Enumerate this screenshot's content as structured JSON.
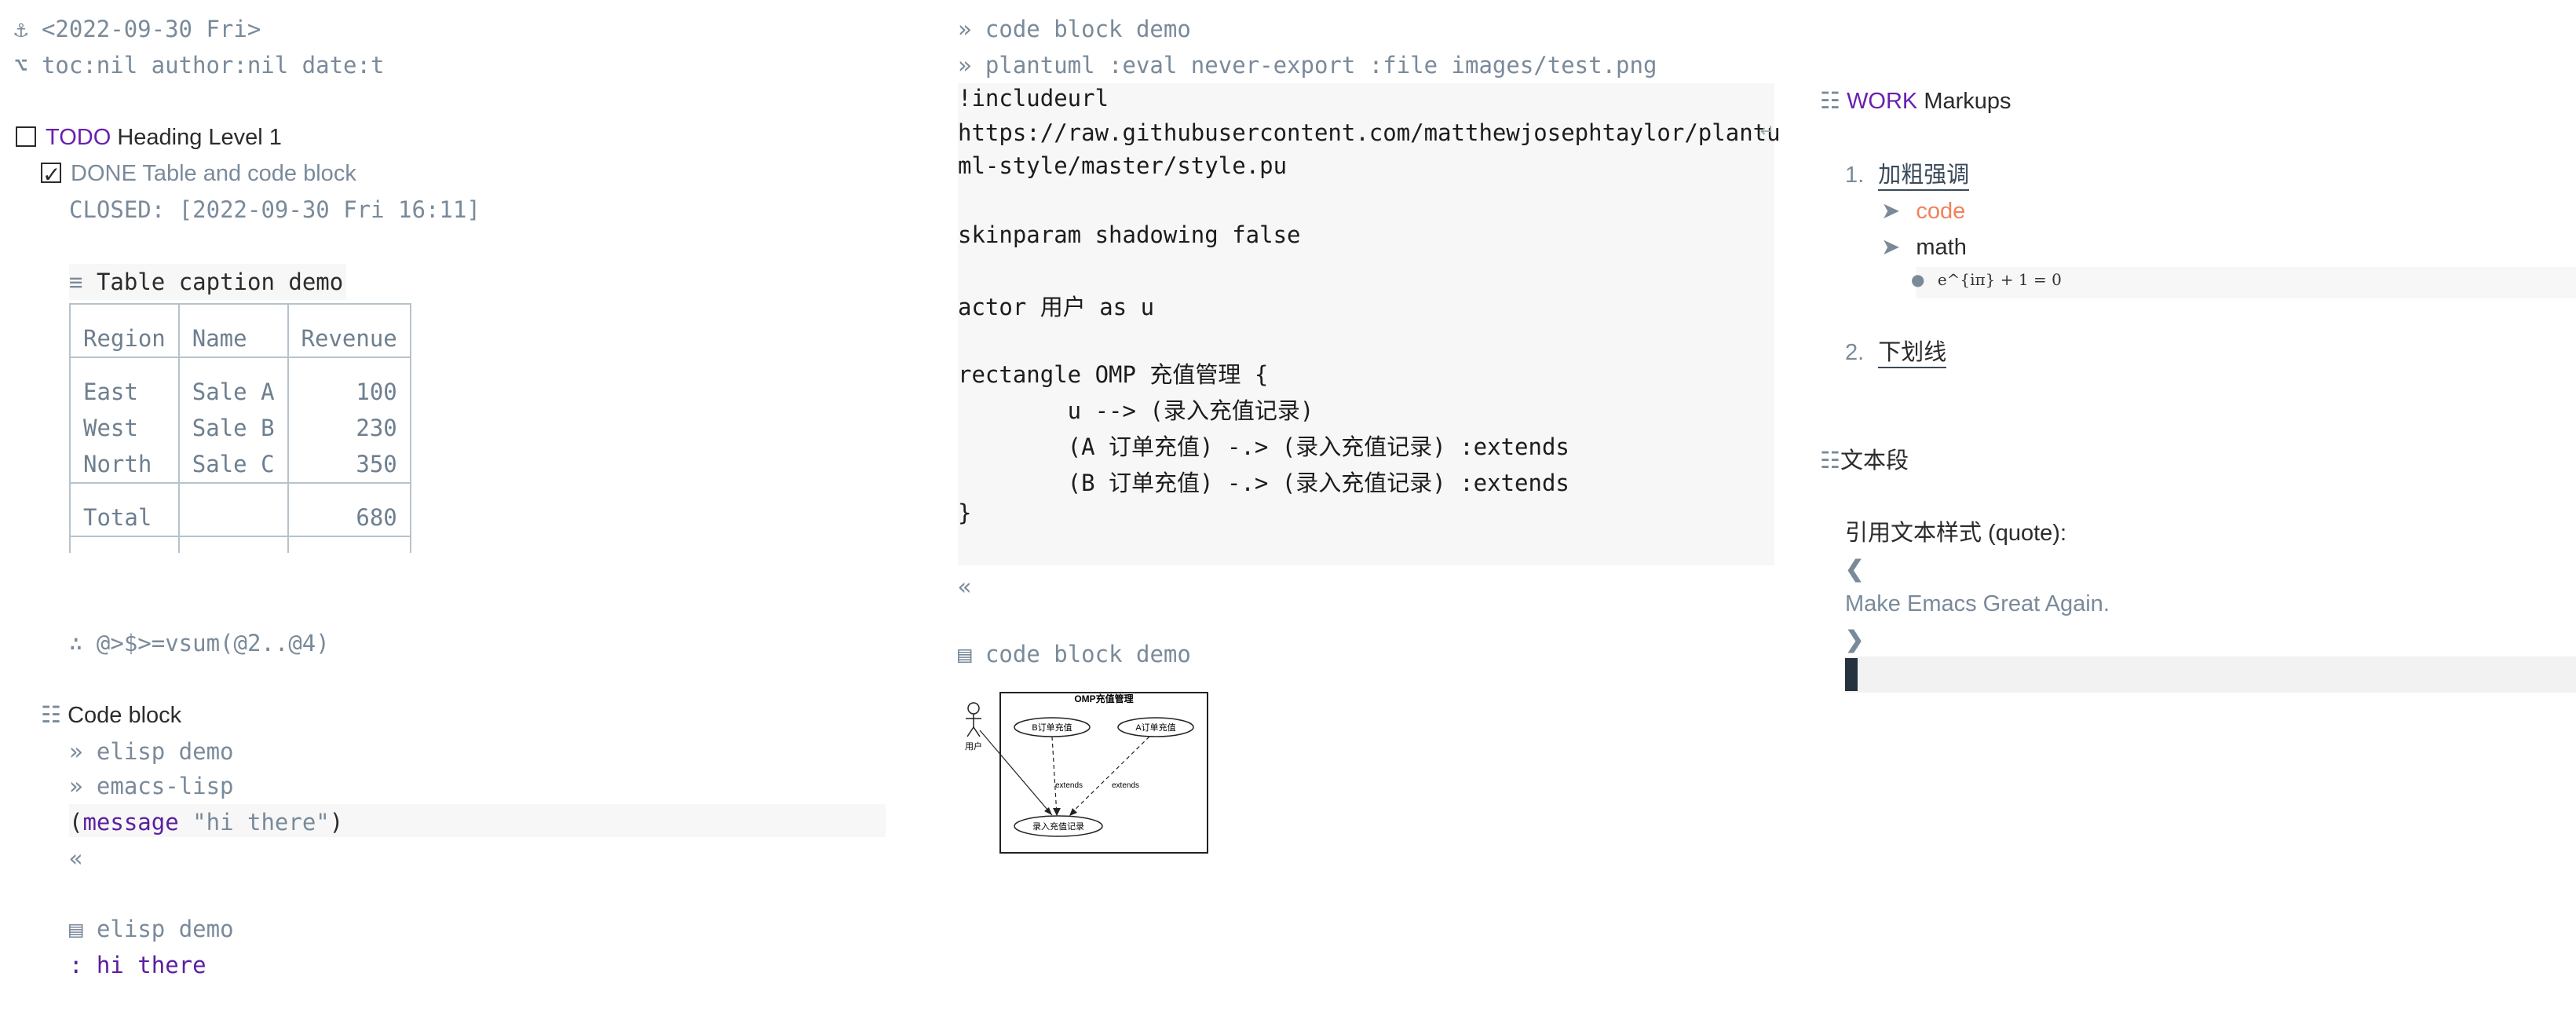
{
  "header": {
    "date_icon": "anchor-icon",
    "date": "<2022-09-30 Fri>",
    "options_icon": "option-key-icon",
    "options": "toc:nil author:nil date:t"
  },
  "heading1": {
    "keyword": "TODO",
    "title": "Heading Level 1"
  },
  "heading2": {
    "keyword": "DONE",
    "title": "Table and code block",
    "closed_label": "CLOSED:",
    "closed_value": "[2022-09-30 Fri 16:11]"
  },
  "table": {
    "caption": "Table caption demo",
    "headers": [
      "Region",
      "Name",
      "Revenue"
    ],
    "rows": [
      [
        "East",
        "Sale A",
        "100"
      ],
      [
        "West",
        "Sale B",
        "230"
      ],
      [
        "North",
        "Sale C",
        "350"
      ]
    ],
    "total": [
      "Total",
      "",
      "680"
    ],
    "formula": "∴ @>$>=vsum(@2..@4)"
  },
  "code_block_heading": {
    "title": "Code block"
  },
  "elisp": {
    "name": "» elisp demo",
    "lang": "» emacs-lisp",
    "code_open": "(",
    "code_fn": "message",
    "code_str": " \"hi there\"",
    "code_close": ")",
    "end": "«",
    "result_label": "elisp demo",
    "result": ": hi there"
  },
  "plantuml": {
    "name": "» code block demo",
    "header": "» plantuml :eval never-export :file images/test.png",
    "lines": [
      "!includeurl",
      "https://raw.githubusercontent.com/matthewjosephtaylor/plantu",
      "ml-style/master/style.pu",
      "",
      "skinparam shadowing false",
      "",
      "actor 用户 as u",
      "",
      "rectangle OMP 充值管理 {",
      "        u --> (录入充值记录)",
      "        (A 订单充值) -.> (录入充值记录) :extends",
      "        (B 订单充值) -.> (录入充值记录) :extends",
      "}"
    ],
    "end": "«",
    "result_label": "code block demo",
    "diagram": {
      "title": "OMP充值管理",
      "actor": "用户",
      "use_b": "B订单充值",
      "use_a": "A订单充值",
      "use_main": "录入充值记录",
      "ext1": "extends",
      "ext2": "extends"
    }
  },
  "markups": {
    "keyword": "WORK",
    "title": "Markups",
    "item1_num": "1.",
    "item1": "加粗强调",
    "sub1": "code",
    "sub2": "math",
    "math": "e^{iπ} + 1 = 0",
    "item2_num": "2.",
    "item2": "下划线"
  },
  "text_section": {
    "title": "文本段",
    "quote_label": "引用文本样式 (quote):",
    "quote_open": "❮",
    "quote": "Make Emacs Great Again.",
    "quote_close": "❯"
  },
  "colors": {
    "todo": "#6a1fb0",
    "muted": "#7a8a9a",
    "code_accent": "#f0825a",
    "code_bg": "#f7f7f7"
  }
}
